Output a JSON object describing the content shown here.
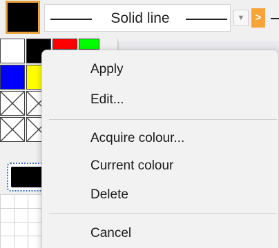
{
  "toolbar": {
    "current_color": "#000000",
    "line_style_label": "Solid line",
    "dropdown_icon": "chevron-down-icon",
    "next_icon": "chevron-right-icon",
    "next_symbol": ">",
    "dropdown_symbol": "▼",
    "accent_color": "#f6a43a"
  },
  "palette": {
    "swatch_colors": [
      "#ffffff",
      "#000000",
      "#ff0000",
      "#00ff00",
      "#0000ff",
      "#ffff00"
    ],
    "empty_swatch_icon": "crossed-box-icon",
    "selected_fill_color": "#000000"
  },
  "context_menu": {
    "items": [
      {
        "label": "Apply"
      },
      {
        "label": "Edit..."
      },
      {
        "label": "Acquire colour..."
      },
      {
        "label": "Current colour"
      },
      {
        "label": "Delete"
      },
      {
        "label": "Cancel"
      }
    ]
  }
}
